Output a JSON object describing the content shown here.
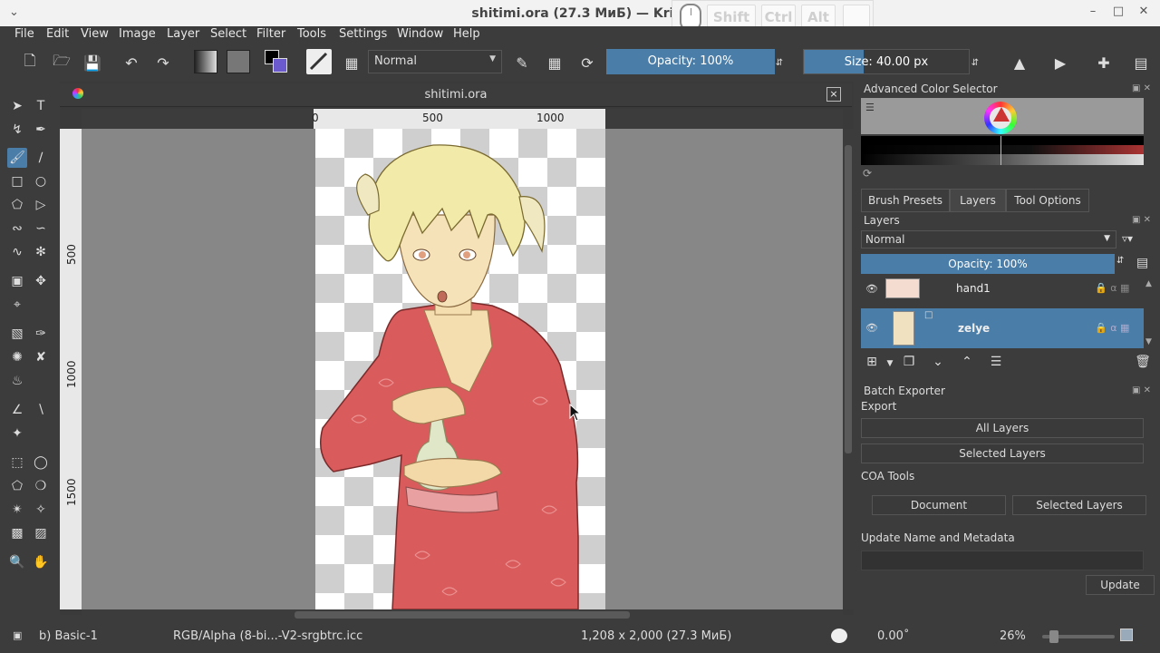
{
  "window": {
    "title": "shitimi.ora (27.3 МиБ) — Krita"
  },
  "key_overlay": {
    "shift": "Shift",
    "ctrl": "Ctrl",
    "alt": "Alt"
  },
  "menu": [
    "File",
    "Edit",
    "View",
    "Image",
    "Layer",
    "Select",
    "Filter",
    "Tools",
    "Settings",
    "Window",
    "Help"
  ],
  "toolbar": {
    "blend_mode": "Normal",
    "opacity": "Opacity: 100%",
    "opacity_value": 1.0,
    "size": "Size: 40.00 px",
    "size_fill": 0.36
  },
  "document": {
    "tab_name": "shitimi.ora",
    "close": "×",
    "ruler_h": [
      "0",
      "500",
      "1000"
    ],
    "ruler_v": [
      "500",
      "1000",
      "1500"
    ]
  },
  "dock": {
    "color_selector_title": "Advanced Color Selector",
    "tabs": [
      "Brush Presets",
      "Layers",
      "Tool Options"
    ],
    "layers_title": "Layers",
    "layer_blend": "Normal",
    "layer_opacity": "Opacity:  100%",
    "layers": [
      {
        "name": "hand1",
        "selected": false
      },
      {
        "name": "zelye",
        "selected": true
      }
    ],
    "batch_exporter_title": "Batch Exporter",
    "export_label": "Export",
    "all_layers": "All Layers",
    "selected_layers": "Selected Layers",
    "coa_tools": "COA Tools",
    "coa_document": "Document",
    "coa_selected_layers": "Selected Layers",
    "update_meta": "Update Name and Metadata",
    "update_button": "Update"
  },
  "status": {
    "brush": "b) Basic-1",
    "color_profile": "RGB/Alpha (8-bi...-V2-srgbtrc.icc",
    "dimensions": "1,208 x 2,000 (27.3 МиБ)",
    "rotation": "0.00˚",
    "zoom": "26%"
  },
  "colors": {
    "accent": "#4a7da8",
    "panel": "#3c3c3c",
    "canvas_bg": "#878787"
  }
}
